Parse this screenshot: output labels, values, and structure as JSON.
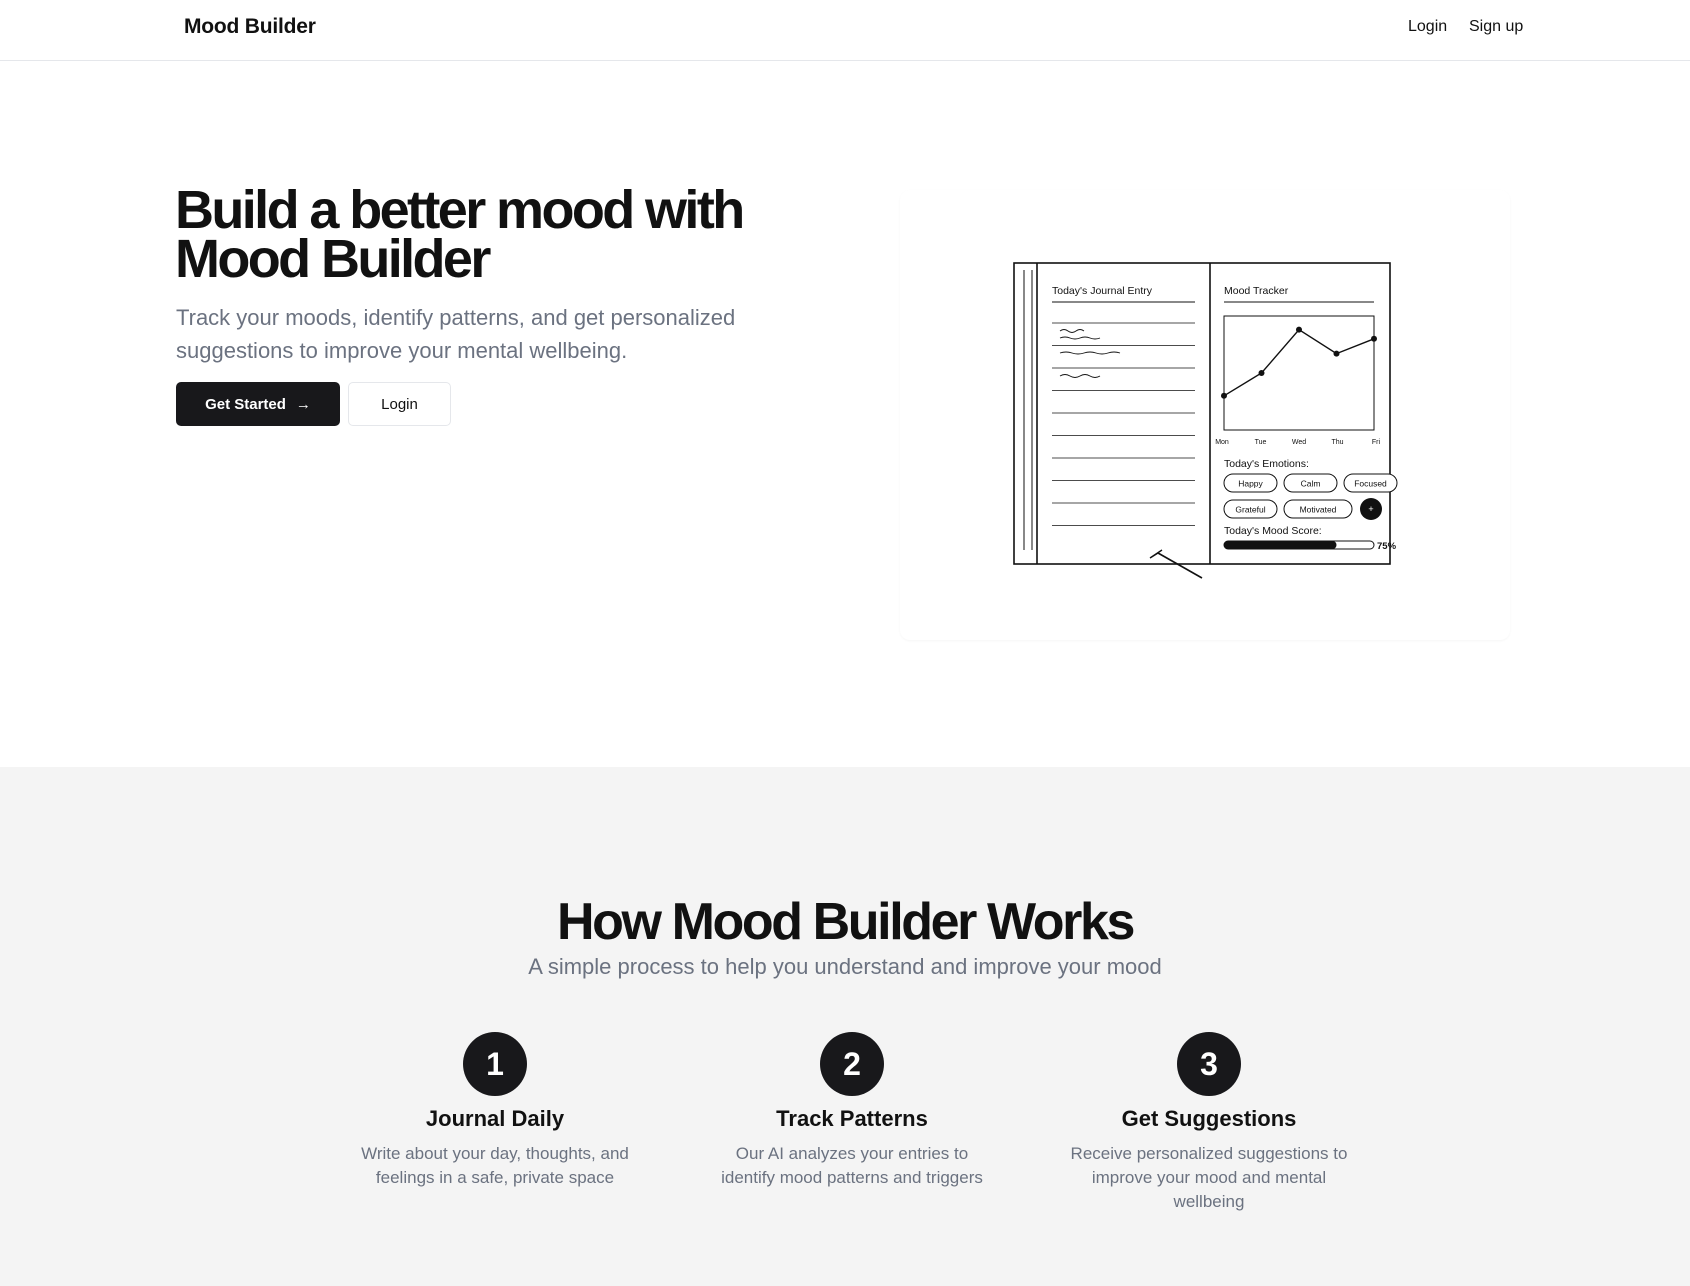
{
  "header": {
    "brand": "Mood Builder",
    "login_label": "Login",
    "signup_label": "Sign up"
  },
  "hero": {
    "title": "Build a better mood with Mood Builder",
    "subtitle": "Track your moods, identify patterns, and get personalized suggestions to improve your mental wellbeing.",
    "primary_button": "Get Started",
    "secondary_button": "Login"
  },
  "illustration": {
    "journal_title": "Today's Journal Entry",
    "tracker_title": "Mood Tracker",
    "days": [
      "Mon",
      "Tue",
      "Wed",
      "Thu",
      "Fri"
    ],
    "mood_points": [
      0.3,
      0.5,
      0.88,
      0.67,
      0.8
    ],
    "emotions_label": "Today's Emotions:",
    "emotions": [
      "Happy",
      "Calm",
      "Focused",
      "Grateful",
      "Motivated"
    ],
    "add_label": "+",
    "score_label": "Today's Mood Score:",
    "score_value": 0.75,
    "score_text": "75%"
  },
  "how": {
    "title": "How Mood Builder Works",
    "subtitle": "A simple process to help you understand and improve your mood",
    "steps": [
      {
        "number": "1",
        "title": "Journal Daily",
        "description": "Write about your day, thoughts, and feelings in a safe, private space"
      },
      {
        "number": "2",
        "title": "Track Patterns",
        "description": "Our AI analyzes your entries to identify mood patterns and triggers"
      },
      {
        "number": "3",
        "title": "Get Suggestions",
        "description": "Receive personalized suggestions to improve your mood and mental wellbeing"
      }
    ]
  }
}
